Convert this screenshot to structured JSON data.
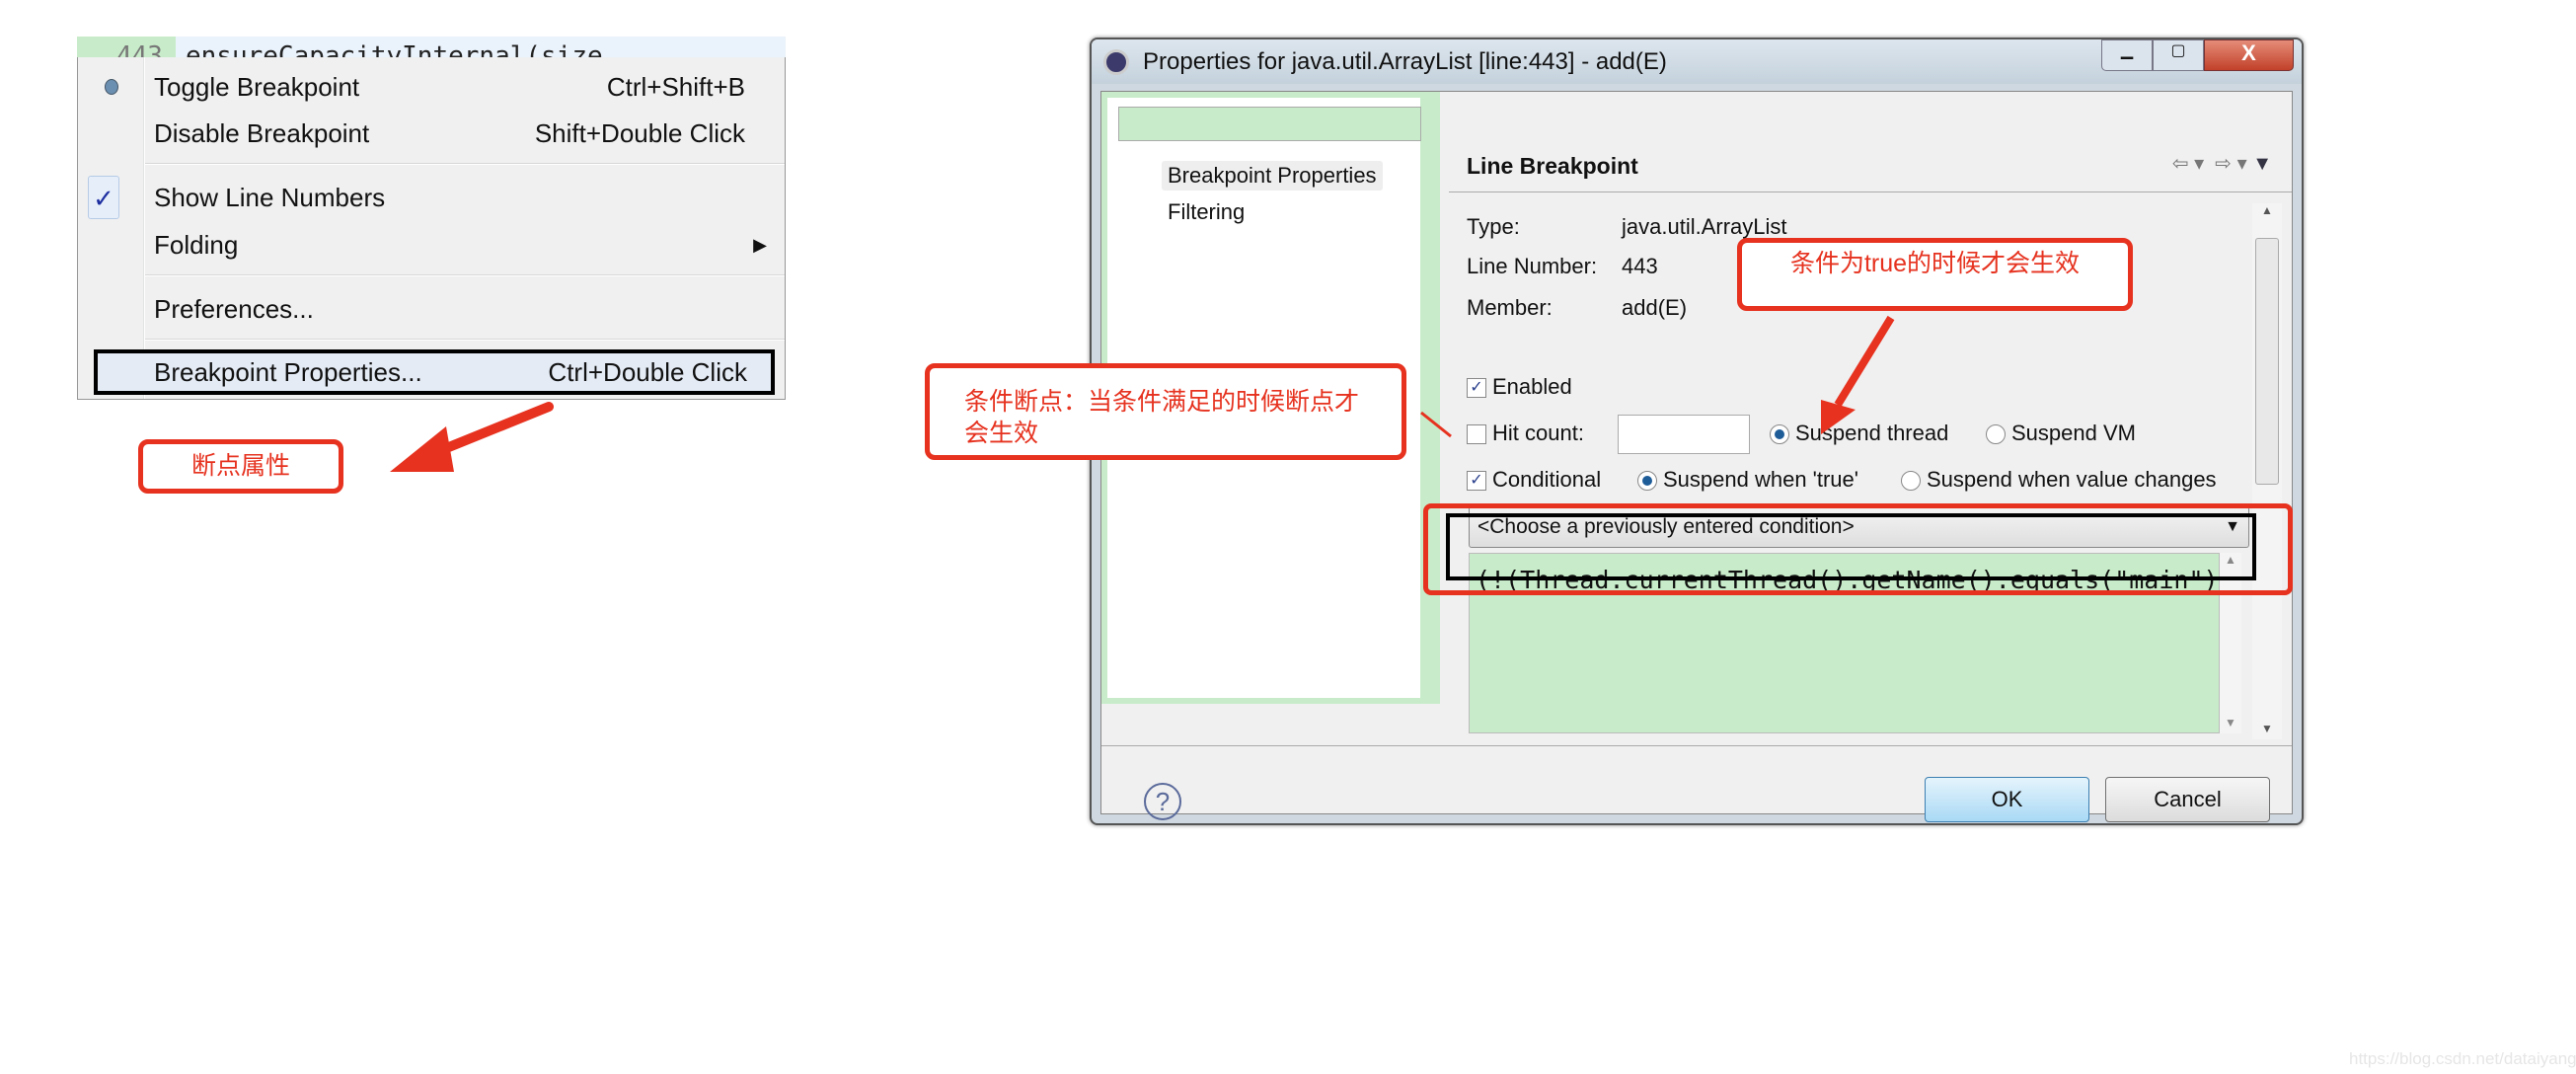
{
  "editor": {
    "line_number": "443",
    "code": "ensureCapacityInternal(size"
  },
  "context_menu": {
    "items": [
      {
        "label": "Toggle Breakpoint",
        "shortcut": "Ctrl+Shift+B",
        "icon": "breakpoint-dot-icon"
      },
      {
        "label": "Disable Breakpoint",
        "shortcut": "Shift+Double Click"
      },
      {
        "label": "Show Line Numbers",
        "checked": true,
        "icon": "checkmark-icon"
      },
      {
        "label": "Folding",
        "submenu": true
      },
      {
        "label": "Preferences..."
      },
      {
        "label": "Breakpoint Properties...",
        "shortcut": "Ctrl+Double Click",
        "highlighted": true
      }
    ]
  },
  "annotations": {
    "menu_label": "断点属性",
    "conditional_note": "条件断点：当条件满足的时候断点才会生效",
    "true_note": "条件为true的时候才会生效",
    "accent_color": "#e6321f"
  },
  "dialog": {
    "title": "Properties for java.util.ArrayList [line:443] - add(E)",
    "filter_value": "",
    "tree": [
      "Breakpoint Properties",
      "Filtering"
    ],
    "header": "Line Breakpoint",
    "type_label": "Type:",
    "type_value": "java.util.ArrayList",
    "line_label": "Line Number:",
    "line_value": "443",
    "member_label": "Member:",
    "member_value": "add(E)",
    "enabled_label": "Enabled",
    "enabled": true,
    "hit_count_label": "Hit count:",
    "hit_count_value": "",
    "hit_count": false,
    "suspend_thread": "Suspend thread",
    "suspend_vm": "Suspend VM",
    "conditional_label": "Conditional",
    "conditional": true,
    "suspend_true": "Suspend when 'true'",
    "suspend_changes": "Suspend when value changes",
    "condition_combo": "<Choose a previously entered condition>",
    "condition_text": "(!(Thread.currentThread().getName().equals(\"main\")",
    "ok": "OK",
    "cancel": "Cancel"
  },
  "watermark": "https://blog.csdn.net/dataiyangu"
}
